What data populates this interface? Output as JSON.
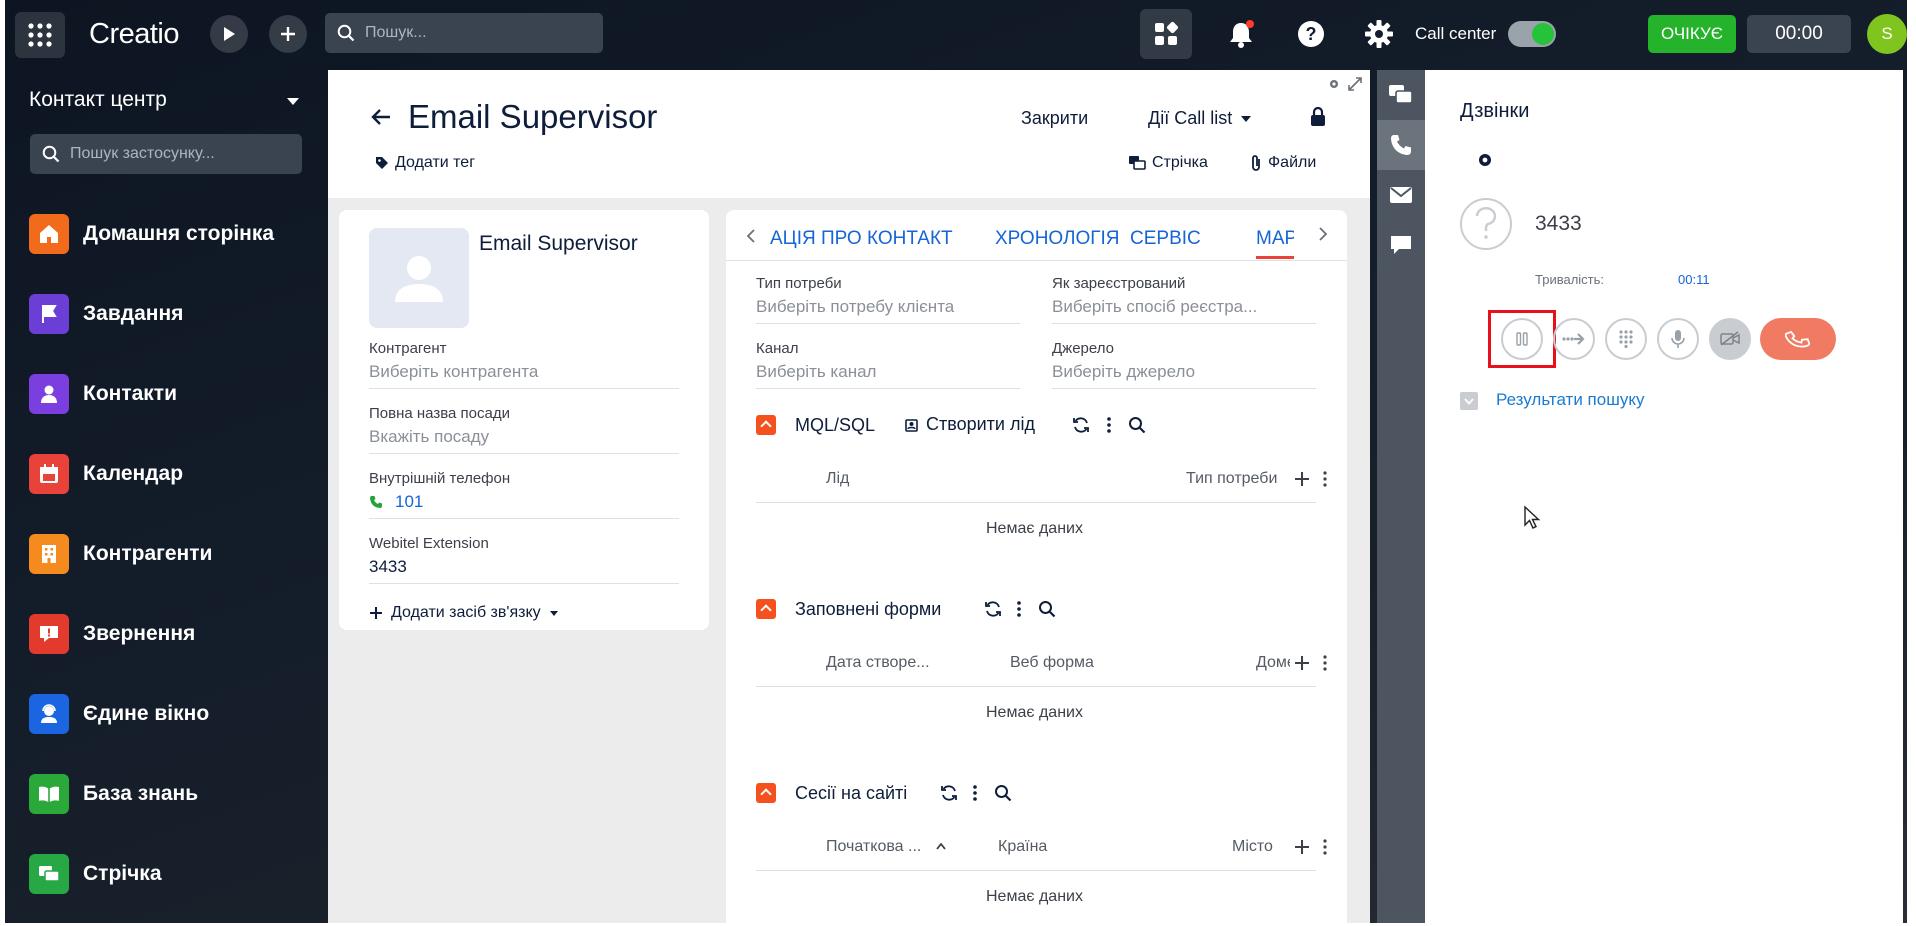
{
  "topbar": {
    "logo": "Creatio",
    "search_placeholder": "Пошук...",
    "callcenter_label": "Call center",
    "status": "ОЧІКУЄ",
    "timer": "00:00",
    "user_initial": "S"
  },
  "sidebar": {
    "title": "Контакт центр",
    "search_placeholder": "Пошук застосунку...",
    "items": [
      {
        "label": "Домашня сторінка",
        "color": "#f26a1b",
        "icon": "home-icon"
      },
      {
        "label": "Завдання",
        "color": "#6b3fd6",
        "icon": "flag-icon"
      },
      {
        "label": "Контакти",
        "color": "#7b3fe0",
        "icon": "person-icon"
      },
      {
        "label": "Календар",
        "color": "#e8423a",
        "icon": "calendar-icon"
      },
      {
        "label": "Контрагенти",
        "color": "#f58a1f",
        "icon": "building-icon"
      },
      {
        "label": "Звернення",
        "color": "#e23b2e",
        "icon": "alert-icon"
      },
      {
        "label": "Єдине вікно",
        "color": "#1b66e0",
        "icon": "agent-icon"
      },
      {
        "label": "База знань",
        "color": "#2aa83a",
        "icon": "book-icon"
      },
      {
        "label": "Стрічка",
        "color": "#28a745",
        "icon": "feed-icon"
      }
    ]
  },
  "record": {
    "title": "Email Supervisor",
    "close": "Закрити",
    "actions": "Дії Call list",
    "add_tag": "Додати тег",
    "feed": "Стрічка",
    "files": "Файли"
  },
  "contact": {
    "name": "Email Supervisor",
    "account_label": "Контрагент",
    "account_placeholder": "Виберіть контрагента",
    "job_label": "Повна назва посади",
    "job_placeholder": "Вкажіть посаду",
    "phone_label": "Внутрішній телефон",
    "phone_value": "101",
    "ext_label": "Webitel Extension",
    "ext_value": "3433",
    "add_contact": "Додати засіб зв'язку"
  },
  "tabs": [
    "АЦІЯ ПРО КОНТАКТ",
    "ХРОНОЛОГІЯ",
    "СЕРВІС",
    "МАР"
  ],
  "fields": {
    "need_label": "Тип потреби",
    "need_placeholder": "Виберіть потребу клієнта",
    "reg_label": "Як зареєстрований",
    "reg_placeholder": "Виберіть спосіб реєстра...",
    "channel_label": "Канал",
    "channel_placeholder": "Виберіть канал",
    "source_label": "Джерело",
    "source_placeholder": "Виберіть джерело"
  },
  "sections": {
    "mql": {
      "title": "MQL/SQL",
      "create": "Створити лід",
      "col1": "Лід",
      "col2": "Тип потреби",
      "empty": "Немає даних"
    },
    "forms": {
      "title": "Заповнені форми",
      "col1": "Дата створе...",
      "col2": "Веб форма",
      "col3": "Доме",
      "empty": "Немає даних"
    },
    "sessions": {
      "title": "Сесії на сайті",
      "col1": "Початкова ...",
      "col2": "Країна",
      "col3": "Місто",
      "empty": "Немає даних"
    }
  },
  "calls": {
    "title": "Дзвінки",
    "number": "3433",
    "duration_label": "Тривалість:",
    "duration_value": "00:11",
    "search_results": "Результати пошуку"
  }
}
